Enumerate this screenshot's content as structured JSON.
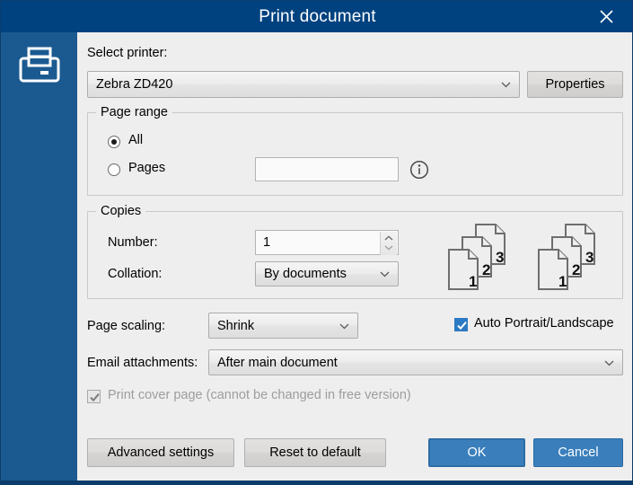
{
  "window": {
    "title": "Print document",
    "close_icon": "close-icon",
    "sidebar_icon": "printer-icon",
    "accent_title_bar": "#004280",
    "accent_sidebar": "#1b5a90",
    "accent_primary_button": "#3a7fbc"
  },
  "printer": {
    "label": "Select printer:",
    "selected": "Zebra ZD420",
    "properties_button": "Properties",
    "chevron_icon": "chevron-down-icon"
  },
  "page_range": {
    "legend": "Page range",
    "options": [
      {
        "label": "All",
        "selected": true
      },
      {
        "label": "Pages",
        "selected": false
      }
    ],
    "pages_value": "",
    "pages_placeholder": "",
    "info_icon": "info-circle-icon"
  },
  "copies": {
    "legend": "Copies",
    "number_label": "Number:",
    "number_value": "1",
    "spinner_up_icon": "chevron-up-icon",
    "spinner_down_icon": "chevron-down-icon",
    "collation_label": "Collation:",
    "collation_value": "By documents",
    "preview_icon": "collated-pages-icon",
    "preview_page_numbers": [
      "1",
      "2",
      "3"
    ],
    "preview_groups": 2
  },
  "options": {
    "page_scaling_label": "Page scaling:",
    "page_scaling_value": "Shrink",
    "auto_orientation_label": "Auto Portrait/Landscape",
    "auto_orientation_checked": true,
    "email_attachments_label": "Email attachments:",
    "email_attachments_value": "After main document",
    "cover_page_label": "Print cover page (cannot be changed in free version)",
    "cover_page_checked": true,
    "cover_page_disabled": true
  },
  "footer": {
    "advanced_settings": "Advanced settings",
    "reset_to_default": "Reset to default",
    "ok": "OK",
    "cancel": "Cancel"
  }
}
